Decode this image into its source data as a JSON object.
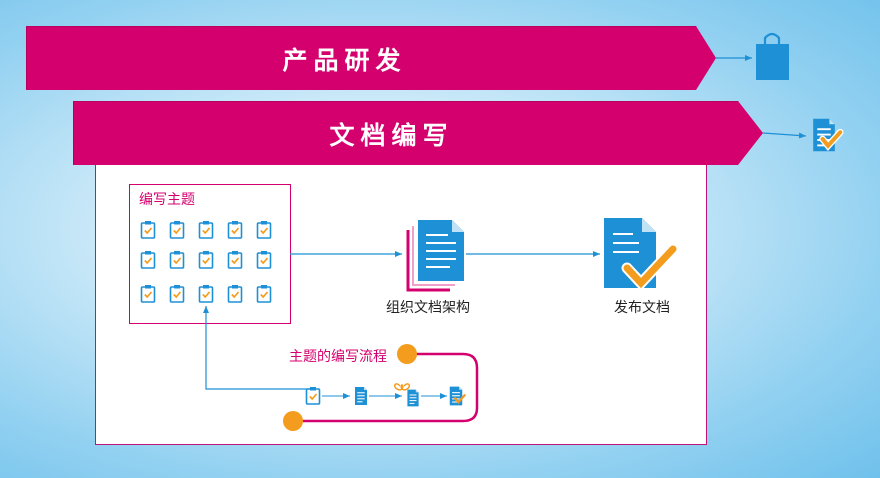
{
  "banners": {
    "product_dev": "产品研发",
    "doc_writing": "文档编写"
  },
  "panel": {
    "write_topics": "编写主题",
    "organize_structure": "组织文档架构",
    "publish_docs": "发布文档",
    "topic_flow": "主题的编写流程"
  },
  "colors": {
    "magenta": "#d4006e",
    "blue": "#1e90d6",
    "orange": "#f39c1e"
  },
  "icons": {
    "product": "shopping-bag-icon",
    "doc_check": "document-check-icon",
    "clipboard": "clipboard-check-icon",
    "doc_stack": "document-stack-icon",
    "loop": "infinity-loop-icon"
  }
}
